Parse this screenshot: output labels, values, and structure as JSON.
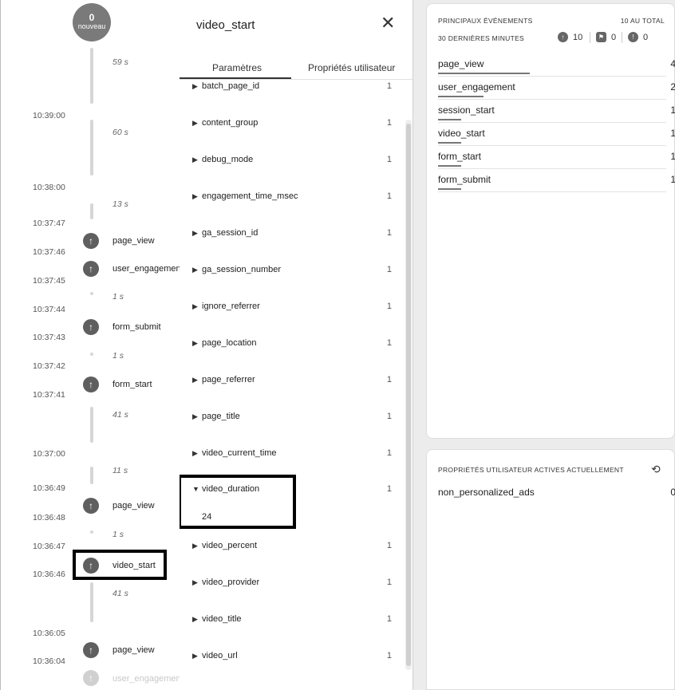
{
  "timeline": {
    "bubble": {
      "count": "0",
      "label": "nouveau"
    },
    "times": [
      "10:39:00",
      "10:38:00",
      "10:37:47",
      "10:37:46",
      "10:37:45",
      "10:37:44",
      "10:37:43",
      "10:37:42",
      "10:37:41",
      "10:37:00",
      "10:36:49",
      "10:36:48",
      "10:36:47",
      "10:36:46",
      "10:36:05",
      "10:36:04"
    ],
    "durations": [
      "59 s",
      "60 s",
      "13 s",
      "1 s",
      "1 s",
      "41 s",
      "11 s",
      "1 s",
      "41 s"
    ],
    "events": [
      "page_view",
      "user_engagement",
      "form_submit",
      "form_start",
      "page_view",
      "video_start",
      "page_view",
      "user_engagement"
    ]
  },
  "detail": {
    "title": "video_start",
    "close_icon": "close-icon",
    "tabs": [
      "Paramètres",
      "Propriétés utilisateur"
    ],
    "params": [
      {
        "name": "batch_page_id",
        "count": "1"
      },
      {
        "name": "content_group",
        "count": "1"
      },
      {
        "name": "debug_mode",
        "count": "1"
      },
      {
        "name": "engagement_time_msec",
        "count": "1"
      },
      {
        "name": "ga_session_id",
        "count": "1"
      },
      {
        "name": "ga_session_number",
        "count": "1"
      },
      {
        "name": "ignore_referrer",
        "count": "1"
      },
      {
        "name": "page_location",
        "count": "1"
      },
      {
        "name": "page_referrer",
        "count": "1"
      },
      {
        "name": "page_title",
        "count": "1"
      },
      {
        "name": "video_current_time",
        "count": "1"
      },
      {
        "name": "video_duration",
        "count": "1",
        "expanded_value": "24"
      },
      {
        "name": "video_percent",
        "count": "1"
      },
      {
        "name": "video_provider",
        "count": "1"
      },
      {
        "name": "video_title",
        "count": "1"
      },
      {
        "name": "video_url",
        "count": "1"
      }
    ]
  },
  "top_events": {
    "heading": "PRINCIPAUX ÉVÉNEMENTS",
    "total": "10 AU TOTAL",
    "subheading": "30 DERNIÈRES MINUTES",
    "counters": [
      "10",
      "0",
      "0"
    ],
    "rows": [
      {
        "name": "page_view",
        "value": "4"
      },
      {
        "name": "user_engagement",
        "value": "2"
      },
      {
        "name": "session_start",
        "value": "1"
      },
      {
        "name": "video_start",
        "value": "1"
      },
      {
        "name": "form_start",
        "value": "1"
      },
      {
        "name": "form_submit",
        "value": "1"
      }
    ]
  },
  "user_props": {
    "heading": "PROPRIÉTÉS UTILISATEUR ACTIVES ACTUELLEMENT",
    "rows": [
      {
        "name": "non_personalized_ads",
        "value": "0"
      }
    ]
  }
}
